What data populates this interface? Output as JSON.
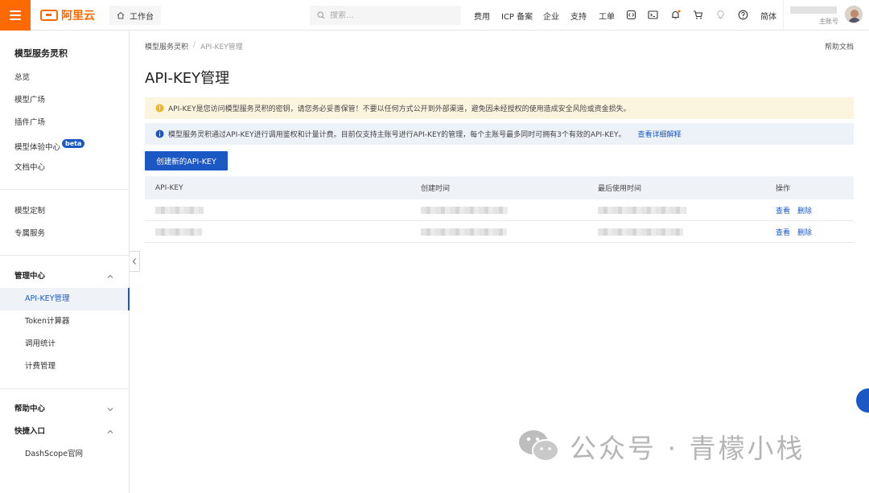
{
  "header": {
    "logo_text": "阿里云",
    "workbench_label": "工作台",
    "search_placeholder": "搜索...",
    "nav": [
      "费用",
      "ICP 备案",
      "企业",
      "支持",
      "工单"
    ],
    "language": "简体",
    "account_role": "主账号"
  },
  "sidebar": {
    "title": "模型服务灵积",
    "items_top": [
      "总览",
      "模型广场",
      "插件广场",
      "模型体验中心",
      "文档中心"
    ],
    "beta_badge": "beta",
    "items_custom": [
      "模型定制",
      "专属服务"
    ],
    "group_manage": "管理中心",
    "items_manage": [
      "API-KEY管理",
      "Token计算器",
      "调用统计",
      "计费管理"
    ],
    "group_help": "帮助中心",
    "group_quick": "快捷入口",
    "items_quick": [
      "DashScope官网"
    ]
  },
  "main": {
    "breadcrumb": [
      "模型服务灵积",
      "API-KEY管理"
    ],
    "help_doc": "帮助文档",
    "page_title": "API-KEY管理",
    "alert_warning": "API-KEY是您访问模型服务灵积的密钥，请您务必妥善保管！不要以任何方式公开到外部渠道，避免因未经授权的使用造成安全风险或资金损失。",
    "alert_info": "模型服务灵积通过API-KEY进行调用鉴权和计量计费。目前仅支持主账号进行API-KEY的管理，每个主账号最多同时可拥有3个有效的API-KEY。",
    "alert_info_link": "查看详细解释",
    "create_button": "创建新的API-KEY",
    "table": {
      "columns": [
        "API-KEY",
        "创建时间",
        "最后使用时间",
        "操作"
      ],
      "row_actions": [
        "查看",
        "删除"
      ]
    }
  },
  "watermark": "公众号 · 青檬小栈",
  "colors": {
    "brand": "#ff6a00",
    "accent": "#1b58c4",
    "warning_bg": "#fbf5e0",
    "info_bg": "#edf2f9"
  }
}
